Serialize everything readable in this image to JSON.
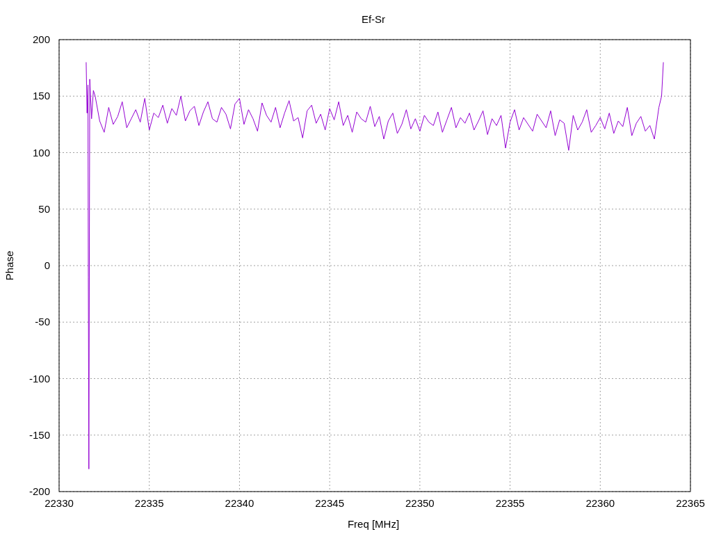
{
  "chart_data": {
    "type": "line",
    "title": "Ef-Sr",
    "xlabel": "Freq [MHz]",
    "ylabel": "Phase",
    "grid": true,
    "xlim": [
      22330,
      22365
    ],
    "ylim": [
      -200,
      200
    ],
    "xticks": [
      22330,
      22335,
      22340,
      22345,
      22350,
      22355,
      22360,
      22365
    ],
    "yticks": [
      -200,
      -150,
      -100,
      -50,
      0,
      50,
      100,
      150,
      200
    ],
    "x": [
      22331.5,
      22331.55,
      22331.6,
      22331.62,
      22331.65,
      22331.7,
      22331.8,
      22331.9,
      22332,
      22332.25,
      22332.5,
      22332.75,
      22333,
      22333.25,
      22333.5,
      22333.75,
      22334,
      22334.25,
      22334.5,
      22334.75,
      22335,
      22335.25,
      22335.5,
      22335.75,
      22336,
      22336.25,
      22336.5,
      22336.75,
      22337,
      22337.25,
      22337.5,
      22337.75,
      22338,
      22338.25,
      22338.5,
      22338.75,
      22339,
      22339.25,
      22339.5,
      22339.75,
      22340,
      22340.25,
      22340.5,
      22340.75,
      22341,
      22341.25,
      22341.5,
      22341.75,
      22342,
      22342.25,
      22342.5,
      22342.75,
      22343,
      22343.25,
      22343.5,
      22343.75,
      22344,
      22344.25,
      22344.5,
      22344.75,
      22345,
      22345.25,
      22345.5,
      22345.75,
      22346,
      22346.25,
      22346.5,
      22346.75,
      22347,
      22347.25,
      22347.5,
      22347.75,
      22348,
      22348.25,
      22348.5,
      22348.75,
      22349,
      22349.25,
      22349.5,
      22349.75,
      22350,
      22350.25,
      22350.5,
      22350.75,
      22351,
      22351.25,
      22351.5,
      22351.75,
      22352,
      22352.25,
      22352.5,
      22352.75,
      22353,
      22353.25,
      22353.5,
      22353.75,
      22354,
      22354.25,
      22354.5,
      22354.75,
      22355,
      22355.25,
      22355.5,
      22355.75,
      22356,
      22356.25,
      22356.5,
      22356.75,
      22357,
      22357.25,
      22357.5,
      22357.75,
      22358,
      22358.25,
      22358.5,
      22358.75,
      22359,
      22359.25,
      22359.5,
      22359.75,
      22360,
      22360.25,
      22360.5,
      22360.75,
      22361,
      22361.25,
      22361.5,
      22361.75,
      22362,
      22362.25,
      22362.5,
      22362.75,
      22363,
      22363.25,
      22363.4,
      22363.5
    ],
    "series": [
      {
        "color": "#9400d3",
        "values": [
          180,
          135,
          160,
          -10,
          -180,
          165,
          130,
          155,
          150,
          128,
          118,
          140,
          125,
          132,
          145,
          122,
          130,
          138,
          127,
          148,
          120,
          135,
          131,
          142,
          126,
          139,
          133,
          150,
          128,
          137,
          141,
          124,
          136,
          145,
          130,
          127,
          140,
          134,
          121,
          143,
          148,
          125,
          138,
          130,
          119,
          144,
          133,
          127,
          140,
          122,
          135,
          146,
          128,
          131,
          113,
          137,
          142,
          126,
          134,
          120,
          139,
          129,
          145,
          124,
          133,
          118,
          136,
          130,
          127,
          141,
          123,
          132,
          112,
          128,
          135,
          117,
          125,
          138,
          121,
          130,
          119,
          133,
          127,
          124,
          136,
          118,
          129,
          140,
          122,
          131,
          126,
          135,
          120,
          128,
          137,
          116,
          130,
          124,
          133,
          104,
          127,
          138,
          120,
          131,
          125,
          119,
          134,
          128,
          122,
          137,
          115,
          129,
          126,
          102,
          133,
          120,
          127,
          138,
          118,
          124,
          131,
          121,
          135,
          117,
          128,
          123,
          140,
          115,
          126,
          132,
          119,
          124,
          112,
          140,
          150,
          180
        ]
      }
    ]
  }
}
